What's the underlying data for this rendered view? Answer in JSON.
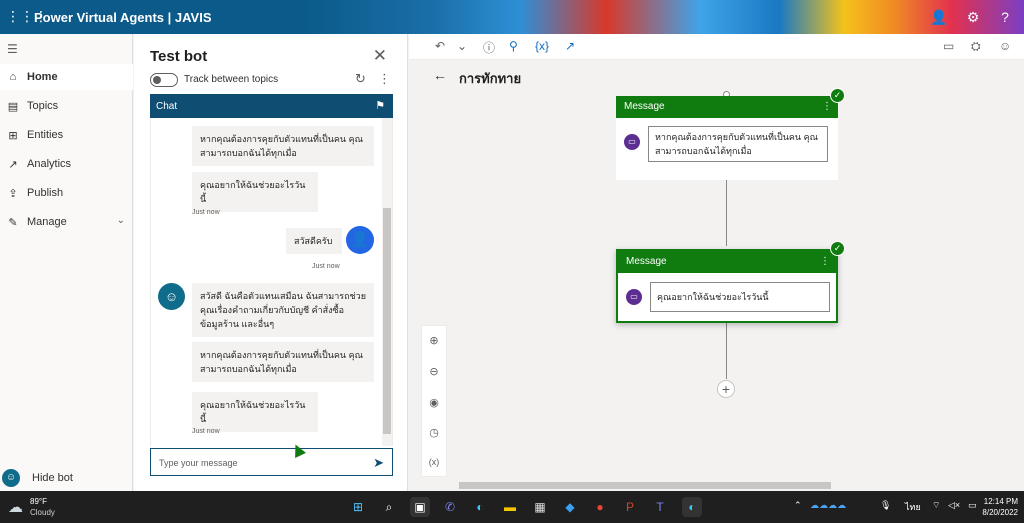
{
  "app": {
    "title": "Power Virtual Agents | JAVIS"
  },
  "nav": {
    "items": [
      {
        "label": "Home",
        "icon": "home-icon"
      },
      {
        "label": "Topics",
        "icon": "topics-icon"
      },
      {
        "label": "Entities",
        "icon": "entities-icon"
      },
      {
        "label": "Analytics",
        "icon": "analytics-icon"
      },
      {
        "label": "Publish",
        "icon": "publish-icon"
      },
      {
        "label": "Manage",
        "icon": "manage-icon"
      }
    ],
    "hide_bot": "Hide bot"
  },
  "testbot": {
    "title": "Test bot",
    "track_label": "Track between topics",
    "chat_header": "Chat",
    "messages": [
      {
        "text": "หากคุณต้องการคุยกับตัวแทนที่เป็นคน คุณ สามารถบอกฉันได้ทุกเมื่อ"
      },
      {
        "text": "คุณอยากให้ฉันช่วยอะไรวันนี้"
      },
      {
        "timestamp": "Just now"
      },
      {
        "text": "สวัสดีครับ"
      },
      {
        "timestamp": "Just now"
      },
      {
        "text": "สวัสดี ฉันคือตัวแทนเสมือน ฉันสามารถช่วยคุณเรื่องคำถามเกี่ยวกับบัญชี คำสั่งซื้อ ข้อมูลร้าน และอื่นๆ"
      },
      {
        "text": "หากคุณต้องการคุยกับตัวแทนที่เป็นคน คุณ สามารถบอกฉันได้ทุกเมื่อ"
      },
      {
        "text": "คุณอยากให้ฉันช่วยอะไรวันนี้"
      },
      {
        "timestamp": "Just now"
      }
    ],
    "input_placeholder": "Type your message"
  },
  "canvas": {
    "topic_title": "การทักทาย",
    "nodes": [
      {
        "header": "Message",
        "text": "หากคุณต้องการคุยกับตัวแทนที่เป็นคน คุณ สามารถบอกฉันได้ทุกเมื่อ"
      },
      {
        "header": "Message",
        "text": "คุณอยากให้ฉันช่วยอะไรวันนี้"
      }
    ],
    "zoom_controls": {
      "zoom_in": "zoom-in-icon",
      "zoom_out": "zoom-out-icon",
      "fit": "fit-view-icon",
      "history": "history-icon",
      "variables": "(x)"
    }
  },
  "taskbar": {
    "weather_temp": "89°F",
    "weather_state": "Cloudy",
    "lang": "ไทย",
    "time": "12:14 PM",
    "date": "8/20/2022"
  },
  "colors": {
    "header": "#0b5a8a",
    "node_green": "#107c10",
    "chat_header": "#0f4d73",
    "user_avatar": "#2266e3"
  }
}
